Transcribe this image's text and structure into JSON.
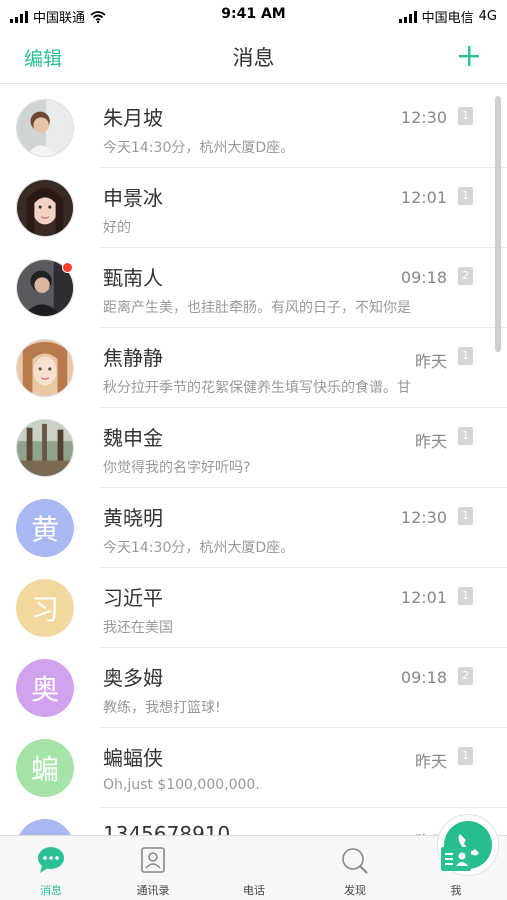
{
  "status_bar": {
    "carrier_left": "中国联通",
    "time": "9:41 AM",
    "carrier_right": "中国电信",
    "network": "4G"
  },
  "nav": {
    "edit_label": "编辑",
    "title": "消息",
    "add_icon": "plus-icon"
  },
  "messages": [
    {
      "name": "朱月坡",
      "preview": "今天14:30分，杭州大厦D座。",
      "time": "12:30",
      "sim": "1",
      "avatar_type": "photo"
    },
    {
      "name": "申景冰",
      "preview": "好的",
      "time": "12:01",
      "sim": "1",
      "avatar_type": "photo"
    },
    {
      "name": "甄南人",
      "preview": "距离产生美，也挂肚牵肠。有风的日子，不知你是",
      "time": "09:18",
      "sim": "2",
      "avatar_type": "photo",
      "unread": true
    },
    {
      "name": "焦静静",
      "preview": "秋分拉开季节的花絮保健养生填写快乐的食谱。甘",
      "time": "昨天",
      "sim": "1",
      "avatar_type": "photo"
    },
    {
      "name": "魏申金",
      "preview": "你觉得我的名字好听吗?",
      "time": "昨天",
      "sim": "1",
      "avatar_type": "photo"
    },
    {
      "name": "黄晓明",
      "preview": "今天14:30分，杭州大厦D座。",
      "time": "12:30",
      "sim": "1",
      "avatar_type": "initial",
      "initial": "黄",
      "color": "#a9b8f0"
    },
    {
      "name": "习近平",
      "preview": "我还在美国",
      "time": "12:01",
      "sim": "1",
      "avatar_type": "initial",
      "initial": "习",
      "color": "#f2d79e"
    },
    {
      "name": "奥多姆",
      "preview": "教练，我想打篮球!",
      "time": "09:18",
      "sim": "2",
      "avatar_type": "initial",
      "initial": "奥",
      "color": "#d1a3ee"
    },
    {
      "name": "蝙蝠侠",
      "preview": "Oh,just $100,000,000.",
      "time": "昨天",
      "sim": "1",
      "avatar_type": "initial",
      "initial": "蝙",
      "color": "#a6e3a8"
    },
    {
      "name": "1345678910",
      "preview": "",
      "time": "昨天",
      "sim": "1",
      "avatar_type": "initial",
      "initial": "",
      "color": "#a9b8f0"
    }
  ],
  "tabbar": {
    "tabs": [
      {
        "label": "消息",
        "icon": "message-icon",
        "active": true
      },
      {
        "label": "通讯录",
        "icon": "contacts-icon",
        "active": false
      },
      {
        "label": "电话",
        "icon": "phone-icon",
        "active": false
      },
      {
        "label": "发现",
        "icon": "discover-icon",
        "active": false
      },
      {
        "label": "我",
        "icon": "profile-icon",
        "active": false
      }
    ]
  },
  "colors": {
    "accent": "#2bbf96",
    "call_button": "#26bd8f",
    "unread": "#ff3b30"
  }
}
